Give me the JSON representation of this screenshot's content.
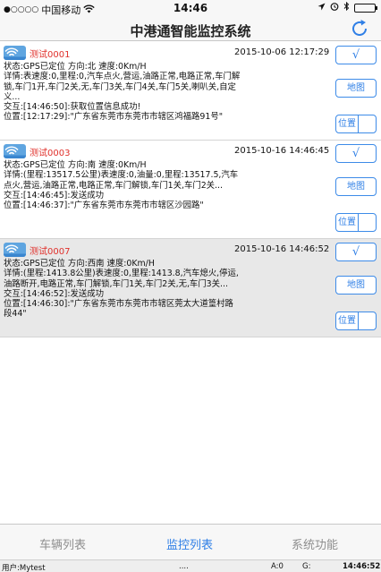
{
  "status_bar": {
    "signal": "●○○○○",
    "carrier": "中国移动",
    "time": "14:46",
    "icons": [
      "wifi-icon",
      "location-arrow-icon",
      "alarm-icon",
      "bluetooth-icon",
      "battery-icon"
    ]
  },
  "nav": {
    "title": "中港通智能监控系统",
    "refresh_icon": "refresh-icon"
  },
  "cards": [
    {
      "name": "测试0001",
      "time": "2015-10-06 12:17:29",
      "body": "状态:GPS已定位 方向:北 速度:0Km/H\n详情:表速度:0,里程:0,汽车点火,营运,油路正常,电路正常,车门解锁,车门1开,车门2关,无,车门3关,车门4关,车门5关,喇叭关,自定义...\n交互:[14:46:50]:获取位置信息成功!\n位置:[12:17:29]:\"广东省东莞市东莞市市辖区鸿福路91号\"",
      "selected": false,
      "buttons": {
        "check": "√",
        "map": "地图",
        "position": "位置"
      }
    },
    {
      "name": "测试0003",
      "time": "2015-10-16 14:46:45",
      "body": "状态:GPS已定位 方向:南 速度:0Km/H\n详情:(里程:13517.5公里)表速度:0,油量:0,里程:13517.5,汽车点火,营运,油路正常,电路正常,车门解锁,车门1关,车门2关...\n交互:[14:46:45]:发送成功\n位置:[14:46:37]:\"广东省东莞市东莞市市辖区沙园路\"",
      "selected": false,
      "buttons": {
        "check": "√",
        "map": "地图",
        "position": "位置"
      }
    },
    {
      "name": "测试0007",
      "time": "2015-10-16 14:46:52",
      "body": "状态:GPS已定位 方向:西南 速度:0Km/H\n详情:(里程:1413.8公里)表速度:0,里程:1413.8,汽车熄火,停运,油路断开,电路正常,车门解锁,车门1关,车门2关,无,车门3关...\n交互:[14:46:52]:发送成功\n位置:[14:46:30]:\"广东省东莞市东莞市市辖区莞太大道篁村路段44\"",
      "selected": true,
      "buttons": {
        "check": "√",
        "map": "地图",
        "position": "位置"
      }
    }
  ],
  "tabs": [
    {
      "label": "车辆列表",
      "active": false
    },
    {
      "label": "监控列表",
      "active": true
    },
    {
      "label": "系统功能",
      "active": false
    }
  ],
  "info_bar": {
    "user": "用户:Mytest",
    "dots": "....",
    "a": "A:0",
    "g": "G:",
    "time": "14:46:52"
  },
  "colors": {
    "accent": "#2f7fe6",
    "vehicle_name": "#e0302b",
    "icon_bg": "#5fa5e0"
  }
}
